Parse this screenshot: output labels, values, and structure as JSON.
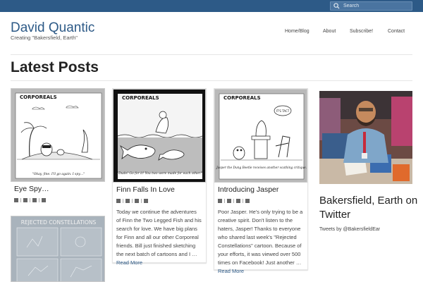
{
  "header": {
    "search_placeholder": "Search",
    "site_title": "David Quantic",
    "tagline": "Creating \"Bakersfield, Earth\"",
    "nav": [
      "Home/Blog",
      "About",
      "Subscribe!",
      "Contact"
    ]
  },
  "main": {
    "heading": "Latest Posts",
    "posts": [
      {
        "title": "Eye Spy…",
        "comic_header": "CORPOREALS",
        "caption": "\"Okay, fine. I'll go again. I spy…\""
      },
      {
        "title": "Finn Falls In Love",
        "comic_header": "CORPOREALS",
        "caption": "\"Dude! Go for it! You two were made for each other!\"",
        "excerpt": "Today we continue the adventures of Finn the Two Legged Fish and his search for love. We have big plans for Finn and all our other Corporeal friends. Bill just finished sketching the next batch of cartoons and I …",
        "read_more": "Read More"
      },
      {
        "title": "Introducing Jasper",
        "comic_header": "CORPOREALS",
        "bubble": "IT'S TACT",
        "caption": "Jasper the Dung Beetle receives another scathing critique.",
        "excerpt": "Poor Jasper. He's only trying to be a creative spirit. Don't listen to the haters, Jasper! Thanks to everyone who shared last week's \"Rejected Constellations\" cartoon. Because of your efforts, it was viewed over 500 times on Facebook! Just another …",
        "read_more": "Read More"
      },
      {
        "title": "",
        "comic_header": "REJECTED CONSTELLATIONS"
      }
    ]
  },
  "sidebar": {
    "title": "Bakersfield, Earth on Twitter",
    "tweets_label": "Tweets by @BakersfieldEar"
  },
  "colors": {
    "topbar": "#2d5a87",
    "accent": "#2d5a87"
  },
  "icons": [
    "search-icon",
    "author-icon",
    "category-icon",
    "comments-icon",
    "date-icon"
  ]
}
